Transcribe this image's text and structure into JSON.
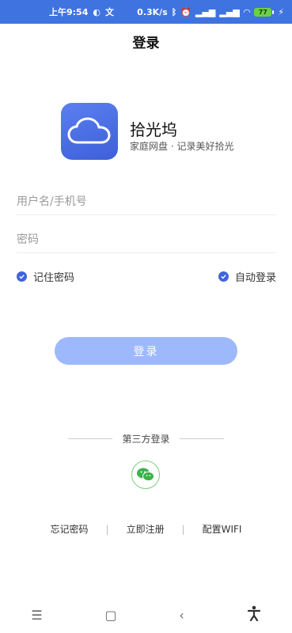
{
  "status_bar": {
    "time": "上午9:54",
    "network_speed": "0.3K/s",
    "battery_level": "77",
    "icons": [
      "notification-icon",
      "translate-icon",
      "bluetooth-icon",
      "alarm-icon",
      "signal-hd-icon",
      "signal-hd-icon-2",
      "wifi-icon",
      "battery-icon",
      "charging-icon"
    ]
  },
  "header": {
    "title": "登录"
  },
  "brand": {
    "app_name": "拾光坞",
    "slogan": "家庭网盘 · 记录美好拾光",
    "logo_icon": "cloud-icon",
    "logo_color": "#4a6be6"
  },
  "form": {
    "username_placeholder": "用户名/手机号",
    "password_placeholder": "密码",
    "remember_label": "记住密码",
    "auto_login_label": "自动登录",
    "login_button": "登录"
  },
  "third_party": {
    "title": "第三方登录",
    "wechat_icon": "wechat-icon"
  },
  "links": {
    "forgot": "忘记密码",
    "register": "立即注册",
    "wifi": "配置WIFI"
  },
  "colors": {
    "accent": "#3f73e0",
    "button_disabled": "#9eb9fb",
    "wechat": "#3bb34a"
  }
}
